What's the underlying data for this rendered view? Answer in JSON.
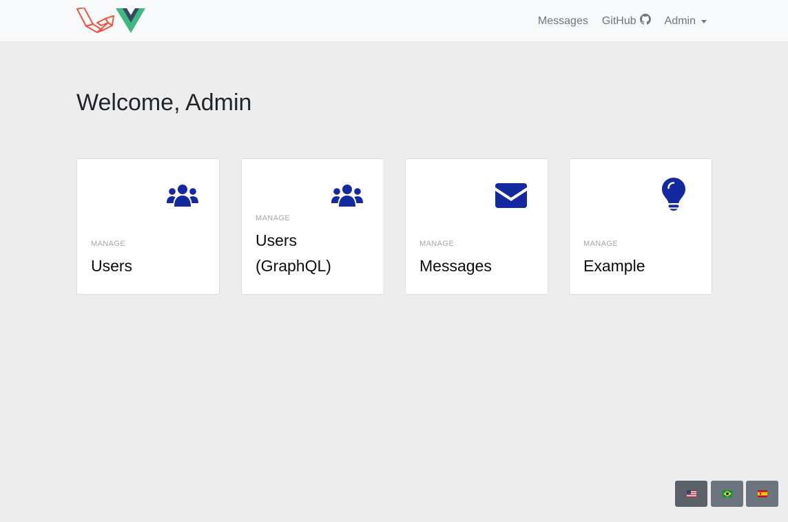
{
  "navbar": {
    "logo_icon": "laravel-vue-logo",
    "links": [
      {
        "label": "Messages"
      },
      {
        "label": "GitHub",
        "icon": "github-icon"
      },
      {
        "label": "Admin",
        "icon": "caret-down-icon"
      }
    ]
  },
  "main": {
    "heading": "Welcome, Admin"
  },
  "cards": [
    {
      "subtitle": "MANAGE",
      "title": "Users",
      "icon": "users-icon"
    },
    {
      "subtitle": "MANAGE",
      "title": "Users (GraphQL)",
      "icon": "users-icon"
    },
    {
      "subtitle": "MANAGE",
      "title": "Messages",
      "icon": "envelope-icon"
    },
    {
      "subtitle": "MANAGE",
      "title": "Example",
      "icon": "lightbulb-icon"
    }
  ],
  "languages": [
    {
      "code": "en-US",
      "flag": "us-flag-icon",
      "active": true
    },
    {
      "code": "pt-BR",
      "flag": "brazil-flag-icon",
      "active": false
    },
    {
      "code": "es",
      "flag": "spain-flag-icon",
      "active": false
    }
  ],
  "colors": {
    "navbar_bg": "#f8f9fa",
    "page_bg": "#ededed",
    "icon_accent": "#1428a0",
    "laravel_red": "#f05340",
    "vue_green": "#41b883",
    "vue_dark": "#35495e",
    "button_gray": "#6c757d"
  }
}
